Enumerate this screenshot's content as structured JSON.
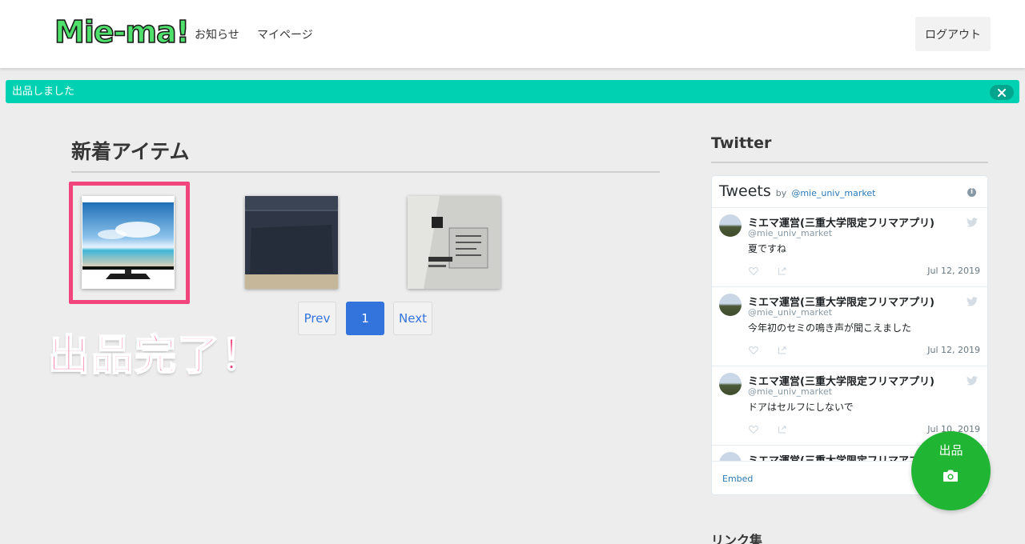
{
  "header": {
    "logo": "Mie-ma!",
    "nav": [
      {
        "label": "お知らせ"
      },
      {
        "label": "マイページ"
      }
    ],
    "logout_label": "ログアウト"
  },
  "flash": {
    "message": "出品しました",
    "color": "#00d1b2"
  },
  "main": {
    "title": "新着アイテム",
    "items": [
      {
        "name": "tv-item-thumbnail",
        "icon": "television-photo"
      },
      {
        "name": "dark-fabric-item-thumbnail",
        "icon": "fabric-photo"
      },
      {
        "name": "appliance-label-item-thumbnail",
        "icon": "label-photo"
      }
    ],
    "annotation": "出品完了！",
    "annotation_color": "#f2457d",
    "pagination": {
      "prev": "Prev",
      "current": "1",
      "next": "Next"
    }
  },
  "sidebar": {
    "twitter_title": "Twitter",
    "widget": {
      "header": "Tweets",
      "by": "by",
      "handle": "@mie_univ_market",
      "tweets": [
        {
          "name": "ミエマ運営(三重大学限定フリマアプリ)",
          "user": "@mie_univ_market",
          "text": "夏ですね",
          "date": "Jul 12, 2019"
        },
        {
          "name": "ミエマ運営(三重大学限定フリマアプリ)",
          "user": "@mie_univ_market",
          "text": "今年初のセミの鳴き声が聞こえました",
          "date": "Jul 12, 2019"
        },
        {
          "name": "ミエマ運営(三重大学限定フリマアプリ)",
          "user": "@mie_univ_market",
          "text": "ドアはセルフにしないで",
          "date": "Jul 10, 2019"
        },
        {
          "name": "ミエマ運営(三重大学限定フリマアプリ)",
          "user": "",
          "text": "",
          "date": ""
        }
      ],
      "embed": "Embed"
    },
    "links_title": "リンク集"
  },
  "fab": {
    "label": "出品",
    "icon": "camera-icon",
    "color": "#21b534"
  }
}
